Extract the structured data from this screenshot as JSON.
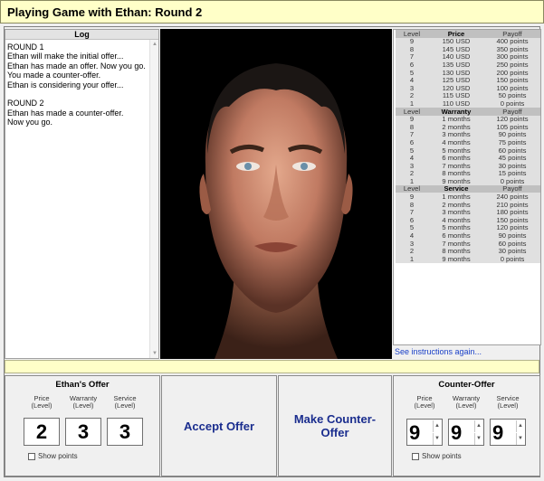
{
  "window": {
    "title": "Playing Game with Ethan: Round 2"
  },
  "log": {
    "title": "Log",
    "text": "ROUND 1\nEthan will make the initial offer...\nEthan has made an offer. Now you go.\nYou made a counter-offer.\nEthan is considering your offer...\n\nROUND 2\nEthan has made a counter-offer.\nNow you go."
  },
  "tables": {
    "price": {
      "headers": [
        "Level",
        "Price",
        "Payoff"
      ],
      "rows": [
        [
          "9",
          "150 USD",
          "400 points"
        ],
        [
          "8",
          "145 USD",
          "350 points"
        ],
        [
          "7",
          "140 USD",
          "300 points"
        ],
        [
          "6",
          "135 USD",
          "250 points"
        ],
        [
          "5",
          "130 USD",
          "200 points"
        ],
        [
          "4",
          "125 USD",
          "150 points"
        ],
        [
          "3",
          "120 USD",
          "100 points"
        ],
        [
          "2",
          "115 USD",
          "50 points"
        ],
        [
          "1",
          "110 USD",
          "0 points"
        ]
      ]
    },
    "warranty": {
      "headers": [
        "Level",
        "Warranty",
        "Payoff"
      ],
      "rows": [
        [
          "9",
          "1 months",
          "120 points"
        ],
        [
          "8",
          "2 months",
          "105 points"
        ],
        [
          "7",
          "3 months",
          "90 points"
        ],
        [
          "6",
          "4 months",
          "75 points"
        ],
        [
          "5",
          "5 months",
          "60 points"
        ],
        [
          "4",
          "6 months",
          "45 points"
        ],
        [
          "3",
          "7 months",
          "30 points"
        ],
        [
          "2",
          "8 months",
          "15 points"
        ],
        [
          "1",
          "9 months",
          "0 points"
        ]
      ]
    },
    "service": {
      "headers": [
        "Level",
        "Service",
        "Payoff"
      ],
      "rows": [
        [
          "9",
          "1 months",
          "240 points"
        ],
        [
          "8",
          "2 months",
          "210 points"
        ],
        [
          "7",
          "3 months",
          "180 points"
        ],
        [
          "6",
          "4 months",
          "150 points"
        ],
        [
          "5",
          "5 months",
          "120 points"
        ],
        [
          "4",
          "6 months",
          "90 points"
        ],
        [
          "3",
          "7 months",
          "60 points"
        ],
        [
          "2",
          "8 months",
          "30 points"
        ],
        [
          "1",
          "9 months",
          "0 points"
        ]
      ]
    }
  },
  "instructions_link": "See instructions again...",
  "ethan_offer": {
    "title": "Ethan's Offer",
    "labels": [
      "Price\n(Level)",
      "Warranty\n(Level)",
      "Service\n(Level)"
    ],
    "values": [
      "2",
      "3",
      "3"
    ],
    "show_points": "Show points"
  },
  "buttons": {
    "accept": "Accept Offer",
    "counter": "Make Counter-Offer"
  },
  "counter_offer": {
    "title": "Counter-Offer",
    "labels": [
      "Price\n(Level)",
      "Warranty\n(Level)",
      "Service\n(Level)"
    ],
    "values": [
      "9",
      "9",
      "9"
    ],
    "show_points": "Show points"
  },
  "colors": {
    "title_bg": "#ffffc8",
    "button_text": "#1a2d8e",
    "link": "#1a40c8"
  }
}
